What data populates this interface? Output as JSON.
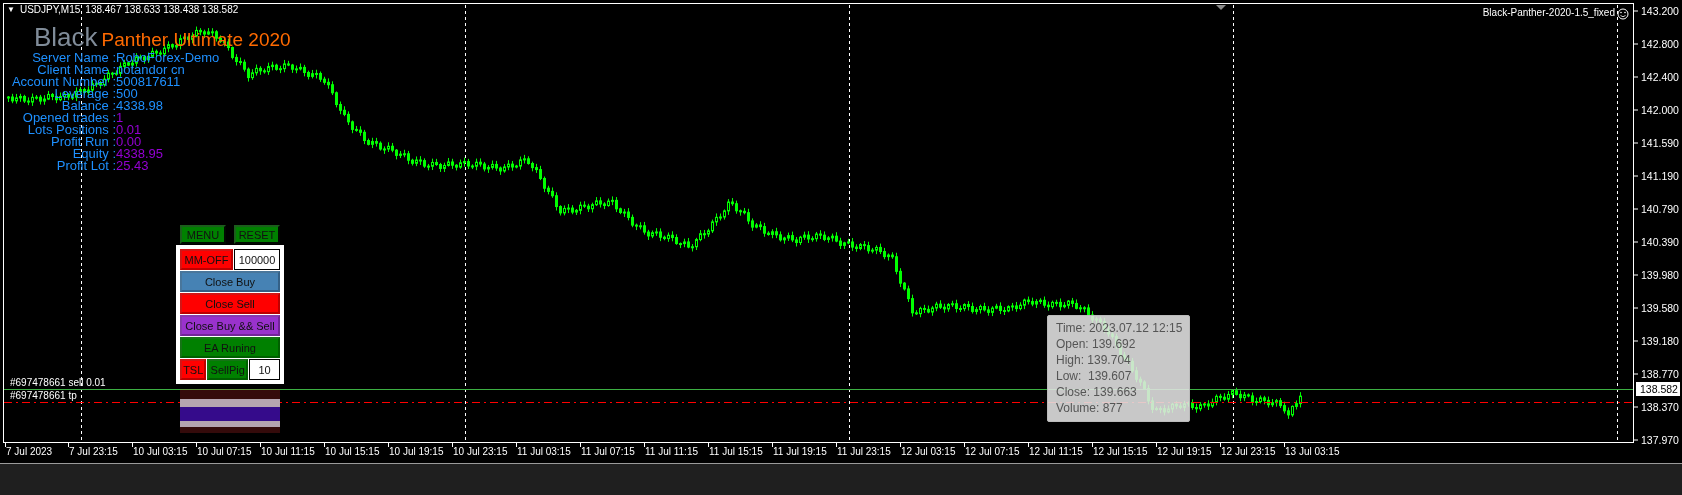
{
  "chart_header": {
    "menu_glyph": "▼",
    "symbol": "USDJPY,M15",
    "quote": "138.467 138.633 138.438 138.582"
  },
  "expert": {
    "name": "Black-Panther-2020-1.5_fixed"
  },
  "brand": {
    "first": "Black",
    "second": "Panther Ultimate 2020"
  },
  "account_info": [
    {
      "label": "Server Name :",
      "value": "RoboForex-Demo",
      "color": "#1e90ff"
    },
    {
      "label": "Client Name :",
      "value": "notandor cn",
      "color": "#1e90ff"
    },
    {
      "label": "Account Number :",
      "value": "500817611",
      "color": "#1e90ff"
    },
    {
      "label": "Leverage :",
      "value": "500",
      "color": "#1e90ff"
    },
    {
      "label": "Balance :",
      "value": "4338.98",
      "color": "#1e90ff"
    },
    {
      "label": "Opened trades :",
      "value": "1",
      "color": "#9400d3"
    },
    {
      "label": "Lots Positions :",
      "value": "0.01",
      "color": "#9400d3"
    },
    {
      "label": "Profit Run :",
      "value": "0.00",
      "color": "#9400d3"
    },
    {
      "label": "Equity :",
      "value": "4338.95",
      "color": "#9400d3"
    },
    {
      "label": "Profit Lot :",
      "value": "25.43",
      "color": "#9400d3"
    }
  ],
  "panel": {
    "top_buttons": [
      {
        "label": "MENU",
        "color": "#008000"
      },
      {
        "label": "RESET",
        "color": "#008000"
      }
    ],
    "rows": [
      {
        "items": [
          {
            "kind": "button",
            "label": "MM-OFF",
            "color": "#ff0000"
          },
          {
            "kind": "field",
            "value": "100000"
          }
        ]
      },
      {
        "items": [
          {
            "kind": "button",
            "label": "Close Buy",
            "color": "#4682b4"
          }
        ]
      },
      {
        "items": [
          {
            "kind": "button",
            "label": "Close Sell",
            "color": "#ff0000"
          }
        ]
      },
      {
        "items": [
          {
            "kind": "button",
            "label": "Close Buy && Sell",
            "color": "#9932cc"
          }
        ]
      },
      {
        "items": [
          {
            "kind": "button",
            "label": "EA Runing",
            "color": "#008000"
          }
        ]
      },
      {
        "items": [
          {
            "kind": "button",
            "label": "TSL",
            "color": "#ff0000"
          },
          {
            "kind": "button",
            "label": "SellPig",
            "color": "#008000"
          },
          {
            "kind": "field",
            "value": "10"
          }
        ]
      }
    ]
  },
  "orders": [
    {
      "label": "#697478661 sell 0.01",
      "kind": "entry"
    },
    {
      "label": "#697478661 tp",
      "kind": "tp"
    }
  ],
  "price_axis": {
    "labels": [
      "143.200",
      "142.800",
      "142.400",
      "142.000",
      "141.590",
      "141.190",
      "140.790",
      "140.390",
      "139.980",
      "139.580",
      "139.180",
      "138.770",
      "138.370",
      "137.970"
    ],
    "current": "138.582"
  },
  "time_axis": {
    "labels": [
      "7 Jul 2023",
      "7 Jul 23:15",
      "10 Jul 03:15",
      "10 Jul 07:15",
      "10 Jul 11:15",
      "10 Jul 15:15",
      "10 Jul 19:15",
      "10 Jul 23:15",
      "11 Jul 03:15",
      "11 Jul 07:15",
      "11 Jul 11:15",
      "11 Jul 15:15",
      "11 Jul 19:15",
      "11 Jul 23:15",
      "12 Jul 03:15",
      "12 Jul 07:15",
      "12 Jul 11:15",
      "12 Jul 15:15",
      "12 Jul 19:15",
      "12 Jul 23:15",
      "13 Jul 03:15"
    ]
  },
  "tooltip": {
    "lines": [
      "Time: 2023.07.12 12:15",
      "Open: 139.692",
      "High: 139.704",
      "Low:  139.607",
      "Close: 139.663",
      "Volume: 877"
    ]
  }
}
